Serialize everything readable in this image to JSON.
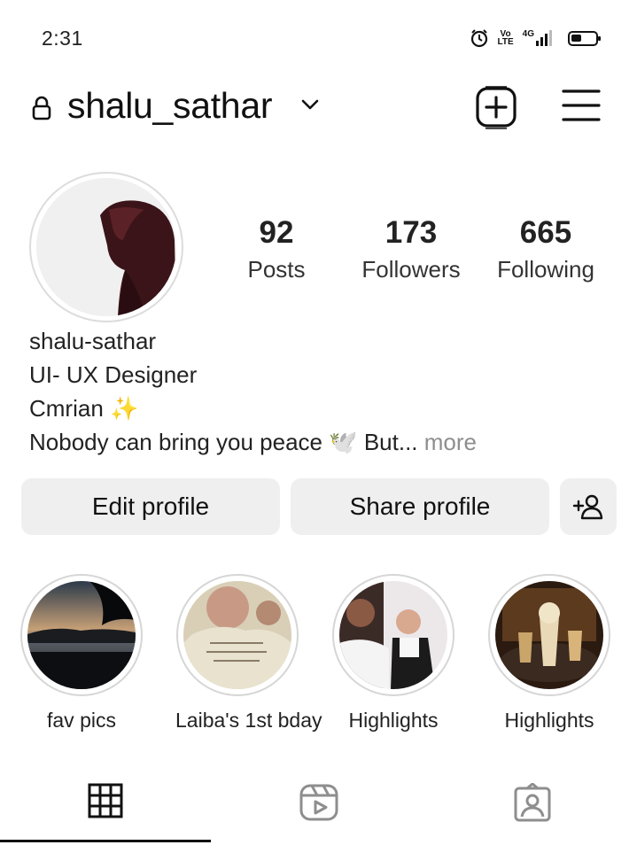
{
  "status_bar": {
    "time": "2:31",
    "icons": [
      "alarm-icon",
      "volte-icon",
      "4g-signal-icon",
      "battery-icon"
    ],
    "volte_text": "Vo\nLTE",
    "network": "4G"
  },
  "header": {
    "username": "shalu_sathar",
    "icons": [
      "lock-icon",
      "chevron-down-icon",
      "create-post-icon",
      "menu-icon"
    ]
  },
  "profile": {
    "stats": [
      {
        "value": "92",
        "label": "Posts"
      },
      {
        "value": "173",
        "label": "Followers"
      },
      {
        "value": "665",
        "label": "Following"
      }
    ],
    "bio": {
      "name": "shalu-sathar",
      "line1": "UI- UX Designer",
      "line2": "Cmrian ✨",
      "line3": "Nobody can bring you peace 🕊️  But...",
      "more": " more"
    }
  },
  "buttons": {
    "edit_profile": "Edit profile",
    "share_profile": "Share profile",
    "discover_people_icon": "add-person-icon"
  },
  "highlights": [
    {
      "label": "fav pics"
    },
    {
      "label": "Laiba's 1st bday"
    },
    {
      "label": "Highlights"
    },
    {
      "label": "Highlights"
    }
  ],
  "tabs": [
    {
      "name": "grid-icon",
      "active": true
    },
    {
      "name": "reels-icon",
      "active": false
    },
    {
      "name": "tagged-icon",
      "active": false
    }
  ],
  "colors": {
    "button_bg": "#efefef",
    "muted_text": "#8e8e8e",
    "ring": "#d6d6d6"
  }
}
